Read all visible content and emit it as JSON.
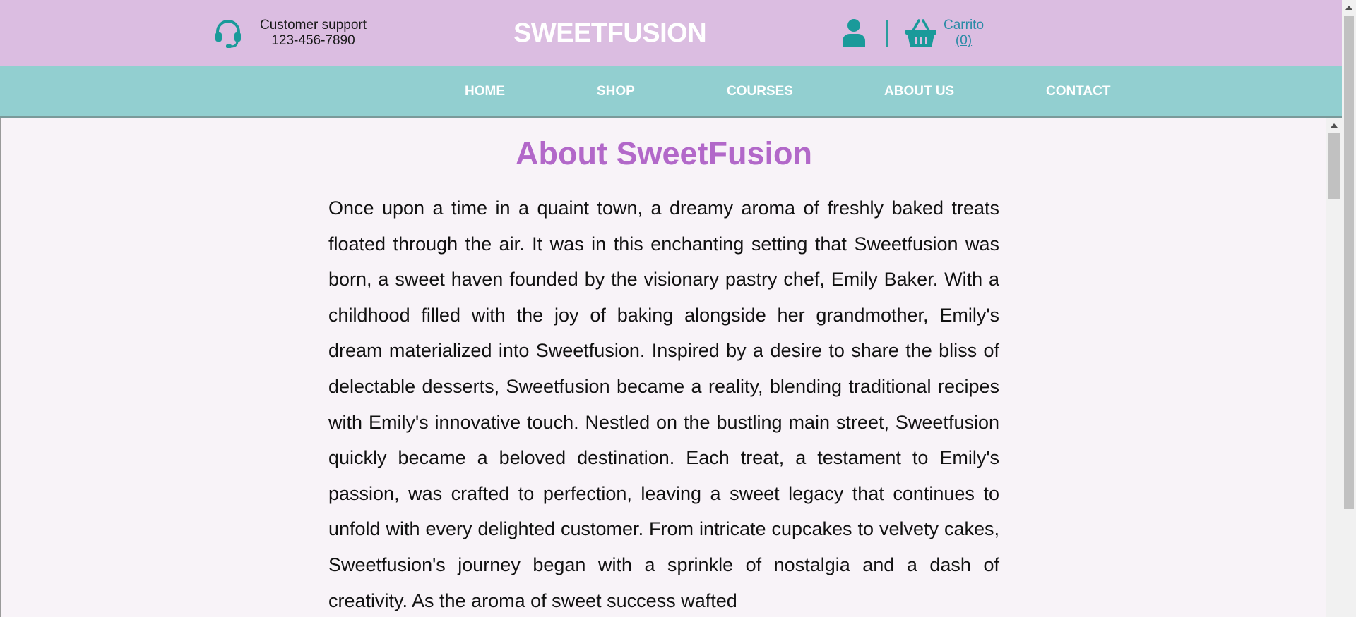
{
  "header": {
    "support_label": "Customer support",
    "support_phone": "123-456-7890",
    "brand": "SWEETFUSION",
    "cart_label": "Carrito",
    "cart_count": "(0)"
  },
  "nav": {
    "items": [
      "HOME",
      "SHOP",
      "COURSES",
      "ABOUT US",
      "CONTACT"
    ]
  },
  "main": {
    "title": "About SweetFusion",
    "body": "Once upon a time in a quaint town, a dreamy aroma of freshly baked treats floated through the air. It was in this enchanting setting that Sweetfusion was born, a sweet haven founded by the visionary pastry chef, Emily Baker. With a childhood filled with the joy of baking alongside her grandmother, Emily's dream materialized into Sweetfusion. Inspired by a desire to share the bliss of delectable desserts, Sweetfusion became a reality, blending traditional recipes with Emily's innovative touch. Nestled on the bustling main street, Sweetfusion quickly became a beloved destination. Each treat, a testament to Emily's passion, was crafted to perfection, leaving a sweet legacy that continues to unfold with every delighted customer. From intricate cupcakes to velvety cakes, Sweetfusion's journey began with a sprinkle of nostalgia and a dash of creativity. As the aroma of sweet success wafted"
  },
  "icons": {
    "support": "headset-icon",
    "user": "user-icon",
    "cart": "basket-icon"
  },
  "colors": {
    "header_bg": "#dbbde1",
    "nav_bg": "#92cfd0",
    "accent_teal": "#1a9a9a",
    "title_purple": "#b268c9",
    "content_bg": "#f8f3f8"
  }
}
